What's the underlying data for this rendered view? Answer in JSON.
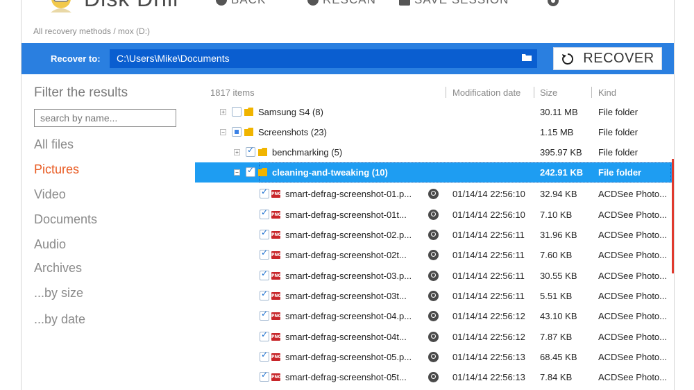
{
  "app": {
    "title": "Disk Drill",
    "actions": [
      {
        "label": "BACK",
        "icon": "back-icon"
      },
      {
        "label": "RESCAN",
        "icon": "rescan-icon"
      },
      {
        "label": "SAVE SESSION",
        "icon": "save-icon"
      }
    ],
    "breadcrumb": "All recovery methods / mox (D:)"
  },
  "recover": {
    "label": "Recover to:",
    "path": "C:\\Users\\Mike\\Documents",
    "button_label": "RECOVER",
    "accent_color": "#2a7fe0"
  },
  "sidebar": {
    "filter_title": "Filter the results",
    "search_placeholder": "search by name...",
    "items": [
      {
        "label": "All files",
        "active": false
      },
      {
        "label": "Pictures",
        "active": true
      },
      {
        "label": "Video",
        "active": false
      },
      {
        "label": "Documents",
        "active": false
      },
      {
        "label": "Audio",
        "active": false
      },
      {
        "label": "Archives",
        "active": false
      },
      {
        "label": "...by size",
        "active": false
      },
      {
        "label": "...by date",
        "active": false
      }
    ]
  },
  "list": {
    "count_label": "1817 items",
    "columns": {
      "date": "Modification date",
      "size": "Size",
      "kind": "Kind"
    },
    "folders": [
      {
        "name": "Samsung S4 (8)",
        "size": "30.11 MB",
        "kind": "File folder",
        "expanded": false,
        "check": "none",
        "level": 0
      },
      {
        "name": "Screenshots (23)",
        "size": "1.15 MB",
        "kind": "File folder",
        "expanded": true,
        "check": "partial",
        "level": 0
      },
      {
        "name": "benchmarking (5)",
        "size": "395.97 KB",
        "kind": "File folder",
        "expanded": false,
        "check": "checked",
        "level": 1
      },
      {
        "name": "cleaning-and-tweaking (10)",
        "size": "242.91 KB",
        "kind": "File folder",
        "expanded": true,
        "check": "checked",
        "level": 1,
        "selected": true
      }
    ],
    "files": [
      {
        "name": "smart-defrag-screenshot-01.p...",
        "date": "01/14/14 22:56:10",
        "size": "32.94 KB",
        "kind": "ACDSee Photo..."
      },
      {
        "name": "smart-defrag-screenshot-01t...",
        "date": "01/14/14 22:56:10",
        "size": "7.10 KB",
        "kind": "ACDSee Photo..."
      },
      {
        "name": "smart-defrag-screenshot-02.p...",
        "date": "01/14/14 22:56:11",
        "size": "31.96 KB",
        "kind": "ACDSee Photo..."
      },
      {
        "name": "smart-defrag-screenshot-02t...",
        "date": "01/14/14 22:56:11",
        "size": "7.60 KB",
        "kind": "ACDSee Photo..."
      },
      {
        "name": "smart-defrag-screenshot-03.p...",
        "date": "01/14/14 22:56:11",
        "size": "30.55 KB",
        "kind": "ACDSee Photo..."
      },
      {
        "name": "smart-defrag-screenshot-03t...",
        "date": "01/14/14 22:56:11",
        "size": "5.51 KB",
        "kind": "ACDSee Photo..."
      },
      {
        "name": "smart-defrag-screenshot-04.p...",
        "date": "01/14/14 22:56:12",
        "size": "43.10 KB",
        "kind": "ACDSee Photo..."
      },
      {
        "name": "smart-defrag-screenshot-04t...",
        "date": "01/14/14 22:56:12",
        "size": "7.87 KB",
        "kind": "ACDSee Photo..."
      },
      {
        "name": "smart-defrag-screenshot-05.p...",
        "date": "01/14/14 22:56:13",
        "size": "68.45 KB",
        "kind": "ACDSee Photo..."
      },
      {
        "name": "smart-defrag-screenshot-05t...",
        "date": "01/14/14 22:56:13",
        "size": "7.84 KB",
        "kind": "ACDSee Photo..."
      }
    ]
  }
}
